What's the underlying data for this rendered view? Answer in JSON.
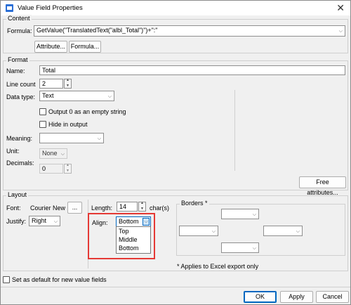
{
  "window": {
    "title": "Value Field Properties",
    "close_glyph": "✕",
    "icon": "app-icon"
  },
  "content": {
    "legend": "Content",
    "formula_label": "Formula:",
    "formula_value": "GetValue(\"TranslatedText(\"albl_Total\")\")+\":\"",
    "attribute_button": "Attribute...",
    "formula_button": "Formula..."
  },
  "format": {
    "legend": "Format",
    "name_label": "Name:",
    "name_value": "Total",
    "line_count_label": "Line count",
    "line_count_value": "2",
    "data_type_label": "Data type:",
    "data_type_value": "Text",
    "output0_label": "Output 0 as an empty string",
    "hide_label": "Hide in output",
    "meaning_label": "Meaning:",
    "meaning_value": "",
    "unit_label": "Unit:",
    "unit_value": "None",
    "decimals_label": "Decimals:",
    "decimals_value": "0",
    "free_attributes_button": "Free attributes..."
  },
  "layout": {
    "legend": "Layout",
    "font_label": "Font:",
    "font_value": "Courier New",
    "font_button": "...",
    "justify_label": "Justify:",
    "justify_value": "Right",
    "length_label": "Length:",
    "length_value": "14",
    "length_unit": "char(s)",
    "align_label": "Align:",
    "align_value": "Bottom",
    "align_options": [
      "Top",
      "Middle",
      "Bottom"
    ],
    "borders_legend": "Borders *",
    "borders_note": "* Applies to Excel export only",
    "highlight_color": "#e53935"
  },
  "footer": {
    "default_label": "Set as default for new value fields",
    "ok": "OK",
    "apply": "Apply",
    "cancel": "Cancel"
  }
}
